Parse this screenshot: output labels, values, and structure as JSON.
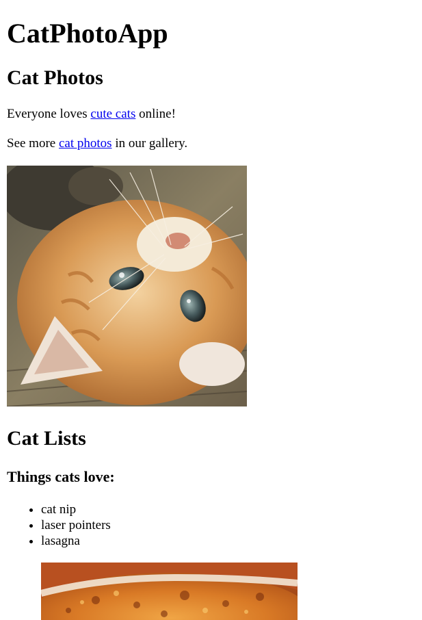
{
  "page": {
    "title": "CatPhotoApp"
  },
  "cat_photos": {
    "heading": "Cat Photos",
    "para1": {
      "before": "Everyone loves ",
      "link": "cute cats",
      "after": " online!"
    },
    "para2": {
      "before": "See more ",
      "link": "cat photos",
      "after": " in our gallery."
    },
    "image_icon": "kitten-photo"
  },
  "cat_lists": {
    "heading": "Cat Lists",
    "subheading": "Things cats love:",
    "items": [
      "cat nip",
      "laser pointers",
      "lasagna"
    ],
    "image_icon": "lasagna-photo"
  },
  "colors": {
    "link": "#0000ee",
    "text": "#000000",
    "background": "#ffffff"
  }
}
